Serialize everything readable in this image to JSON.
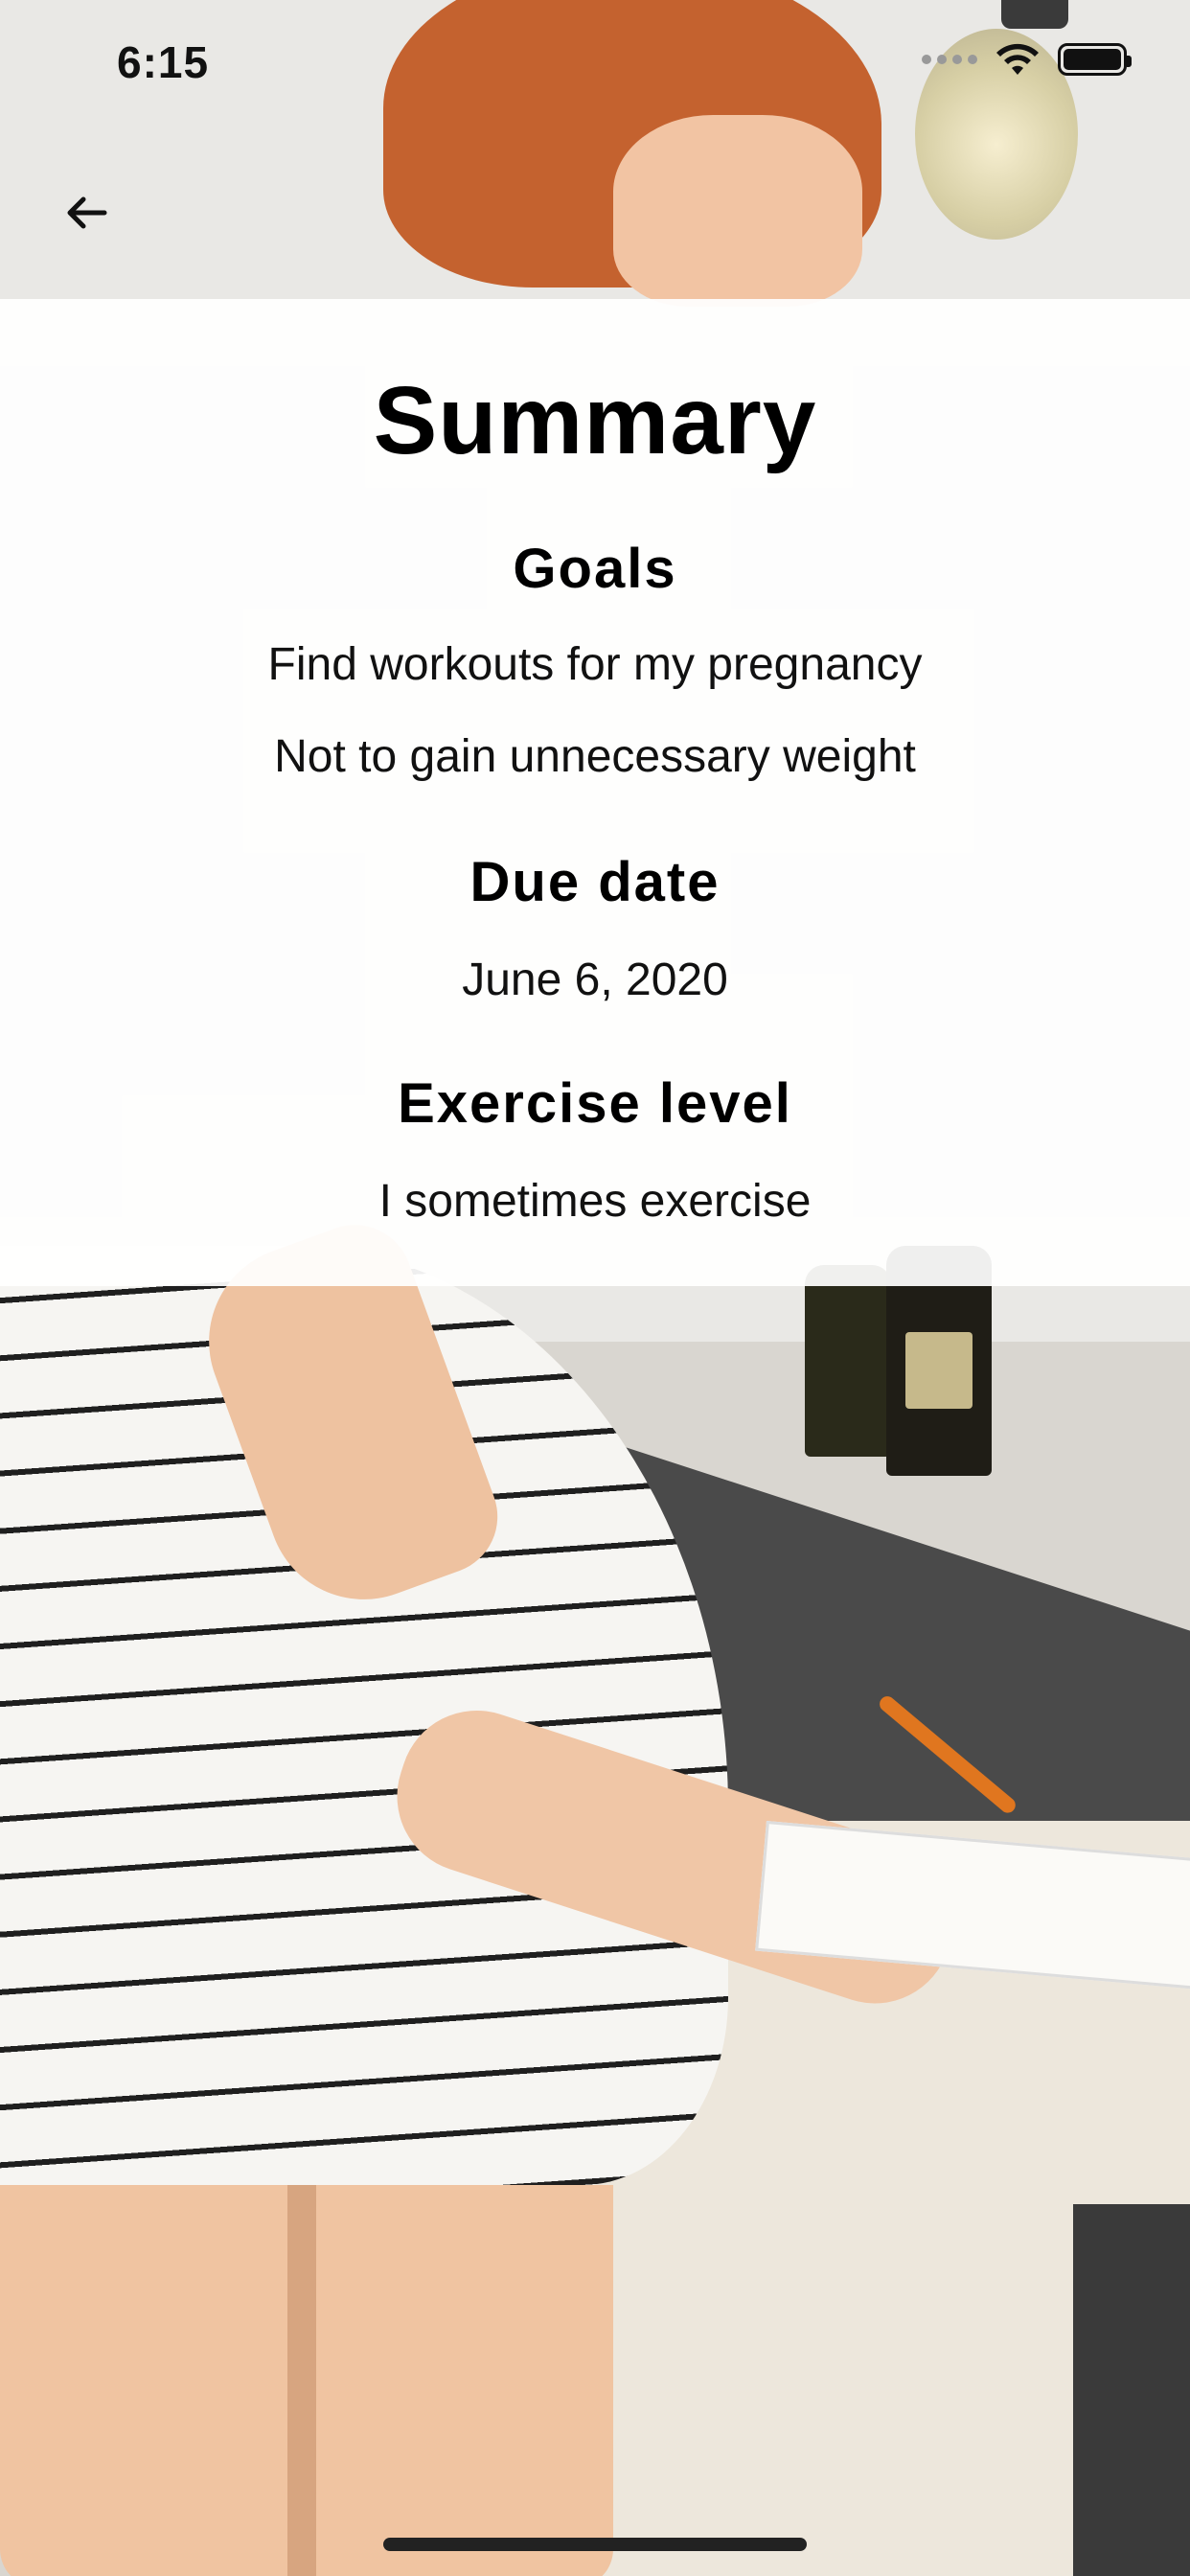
{
  "status_bar": {
    "time": "6:15"
  },
  "summary": {
    "title": "Summary",
    "goals_heading": "Goals",
    "goals": [
      "Find workouts for my pregnancy",
      "Not to gain unnecessary weight"
    ],
    "due_date_heading": "Due date",
    "due_date": "June 6, 2020",
    "exercise_heading": "Exercise level",
    "exercise_level": "I sometimes exercise"
  },
  "colors": {
    "panel": "#ffffff",
    "text": "#000000"
  },
  "icons": {
    "back": "arrow-left-icon",
    "wifi": "wifi-icon",
    "battery": "battery-icon"
  }
}
